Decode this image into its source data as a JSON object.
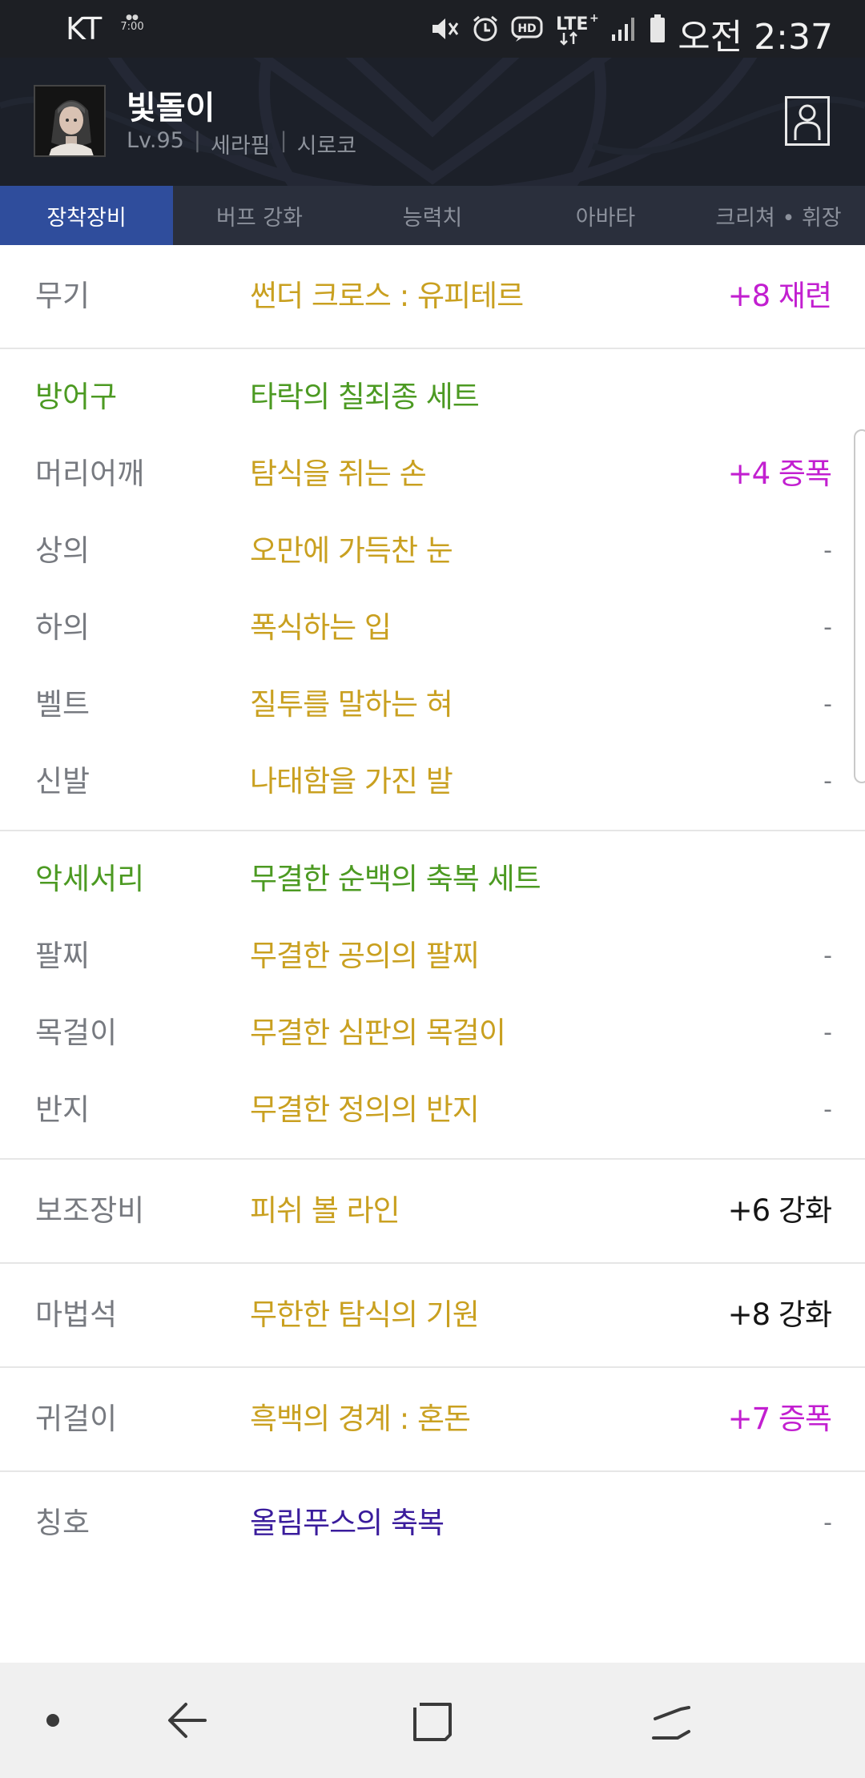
{
  "status_bar": {
    "carrier": "KT",
    "tiny_clock_top": "7:00",
    "time": "오전 2:37",
    "icons": [
      "mute-icon",
      "alarm-icon",
      "hd-icon",
      "lte-plus-icon",
      "signal-icon",
      "battery-icon"
    ]
  },
  "profile": {
    "name": "빛돌이",
    "level": "Lv.95",
    "class": "세라핌",
    "server": "시로코"
  },
  "tabs": [
    {
      "label": "장착장비",
      "active": true
    },
    {
      "label": "버프 강화",
      "active": false
    },
    {
      "label": "능력치",
      "active": false
    },
    {
      "label": "아바타",
      "active": false
    },
    {
      "label": "크리쳐 • 휘장",
      "active": false
    }
  ],
  "weapon": {
    "label": "무기",
    "item": "썬더 크로스 : 유피테르",
    "enhance": "+8 재련"
  },
  "armor": {
    "label": "방어구",
    "set_name": "타락의 칠죄종 세트",
    "items": [
      {
        "label": "머리어깨",
        "item": "탐식을 쥐는 손",
        "enhance": "+4 증폭"
      },
      {
        "label": "상의",
        "item": "오만에 가득찬 눈",
        "enhance": "-"
      },
      {
        "label": "하의",
        "item": "폭식하는 입",
        "enhance": "-"
      },
      {
        "label": "벨트",
        "item": "질투를 말하는 혀",
        "enhance": "-"
      },
      {
        "label": "신발",
        "item": "나태함을 가진 발",
        "enhance": "-"
      }
    ]
  },
  "accessory": {
    "label": "악세서리",
    "set_name": "무결한 순백의 축복 세트",
    "items": [
      {
        "label": "팔찌",
        "item": "무결한 공의의 팔찌",
        "enhance": "-"
      },
      {
        "label": "목걸이",
        "item": "무결한 심판의 목걸이",
        "enhance": "-"
      },
      {
        "label": "반지",
        "item": "무결한 정의의 반지",
        "enhance": "-"
      }
    ]
  },
  "sub_equipment": {
    "label": "보조장비",
    "item": "피쉬 볼 라인",
    "enhance": "+6 강화"
  },
  "magic_stone": {
    "label": "마법석",
    "item": "무한한 탐식의 기원",
    "enhance": "+8 강화"
  },
  "earring": {
    "label": "귀걸이",
    "item": "흑백의 경계 : 혼돈",
    "enhance": "+7 증폭"
  },
  "title_slot": {
    "label": "칭호",
    "item": "올림푸스의 축복",
    "enhance": "-"
  },
  "colors": {
    "item_gold": "#c9a020",
    "set_green": "#4c9a22",
    "amplify_magenta": "#c21fd0",
    "title_purple": "#3a1c9c",
    "active_tab": "#2f4d9c"
  }
}
